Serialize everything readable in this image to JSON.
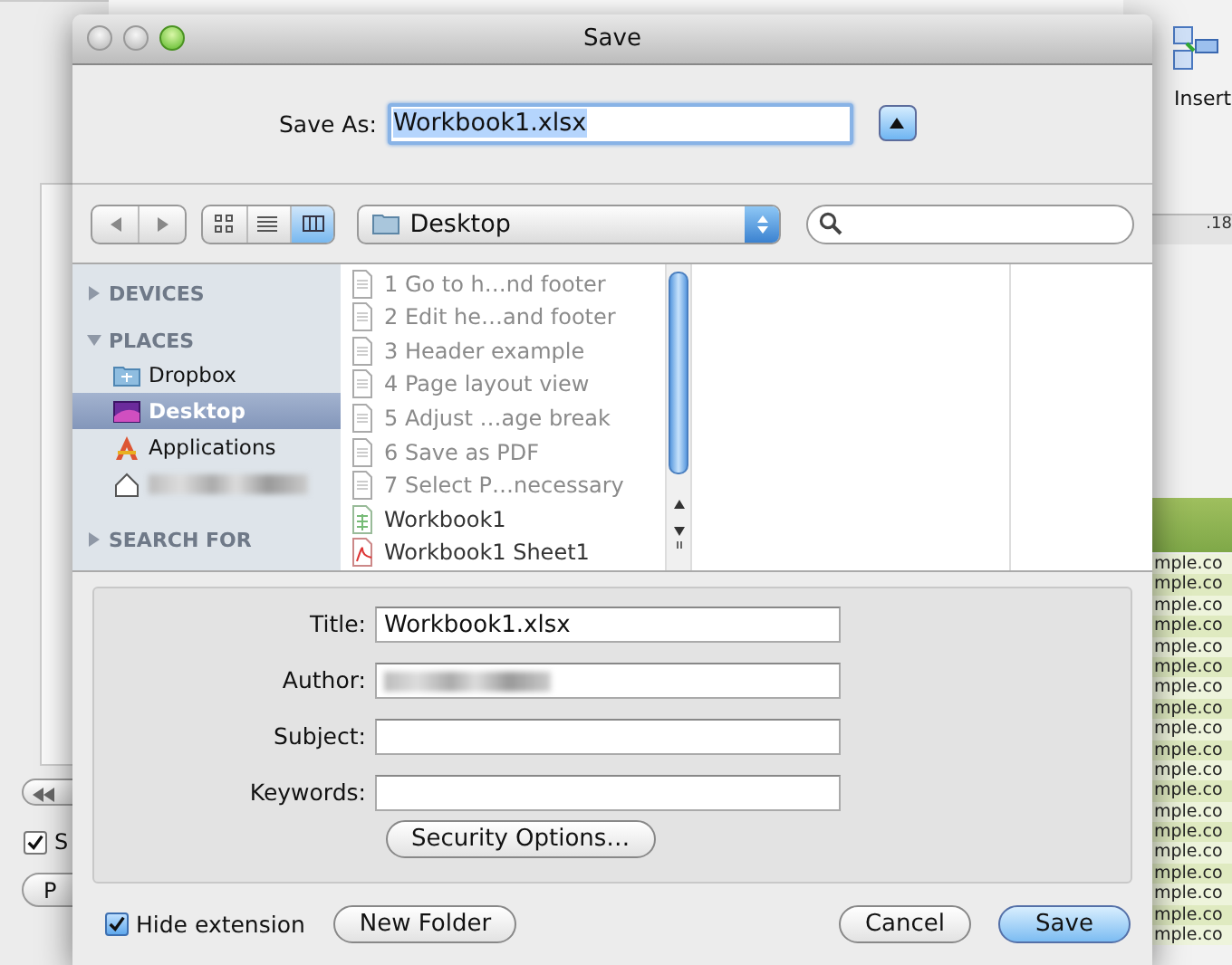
{
  "background_app": {
    "toolbar_label": "Insert",
    "ruler_label": ".18",
    "checkbox": {
      "label": "S",
      "checked": true
    },
    "button": "P",
    "cells": [
      "mple.co",
      "mple.co",
      "mple.co",
      "mple.co",
      "mple.co",
      "mple.co",
      "mple.co",
      "mple.co",
      "mple.co",
      "mple.co",
      "mple.co",
      "mple.co",
      "mple.co",
      "mple.co",
      "mple.co",
      "mple.co",
      "mple.co",
      "mple.co",
      "mple.co"
    ]
  },
  "window": {
    "title": "Save"
  },
  "save_as": {
    "label": "Save As:",
    "value": "Workbook1.xlsx",
    "expanded": true
  },
  "toolbar": {
    "view_modes": [
      {
        "kind": "icons",
        "selected": false
      },
      {
        "kind": "list",
        "selected": false
      },
      {
        "kind": "columns",
        "selected": true
      }
    ],
    "location": "Desktop"
  },
  "sidebar": {
    "sections": [
      {
        "label": "DEVICES",
        "expanded": false
      },
      {
        "label": "PLACES",
        "expanded": true,
        "items": [
          {
            "label": "Dropbox",
            "kind": "dropbox",
            "selected": false
          },
          {
            "label": "Desktop",
            "kind": "desktop",
            "selected": true
          },
          {
            "label": "Applications",
            "kind": "applications",
            "selected": false
          },
          {
            "kind": "home",
            "selected": false,
            "redacted": true
          }
        ]
      },
      {
        "label": "SEARCH FOR",
        "expanded": false
      }
    ]
  },
  "files": [
    {
      "name": "1 Go to h…nd footer",
      "kind": "document",
      "disabled": true
    },
    {
      "name": "2 Edit he…and footer",
      "kind": "document",
      "disabled": true
    },
    {
      "name": "3 Header example",
      "kind": "document",
      "disabled": true
    },
    {
      "name": "4 Page layout view",
      "kind": "document",
      "disabled": true
    },
    {
      "name": "5 Adjust …age break",
      "kind": "document",
      "disabled": true
    },
    {
      "name": "6 Save as PDF",
      "kind": "document",
      "disabled": true
    },
    {
      "name": "7 Select P…necessary",
      "kind": "document",
      "disabled": true
    },
    {
      "name": "Workbook1",
      "kind": "spreadsheet",
      "disabled": false
    },
    {
      "name": "Workbook1 Sheet1",
      "kind": "pdf",
      "disabled": false
    }
  ],
  "properties": [
    {
      "label": "Title:",
      "value": "Workbook1.xlsx"
    },
    {
      "label": "Author:",
      "redacted": true
    },
    {
      "label": "Subject:"
    },
    {
      "label": "Keywords:"
    }
  ],
  "security_button": "Security Options…",
  "footer": {
    "hide_extension": {
      "label": "Hide extension",
      "checked": true
    },
    "new_folder": "New Folder",
    "buttons": [
      {
        "label": "Cancel",
        "default": false
      },
      {
        "label": "Save",
        "default": true
      }
    ]
  }
}
